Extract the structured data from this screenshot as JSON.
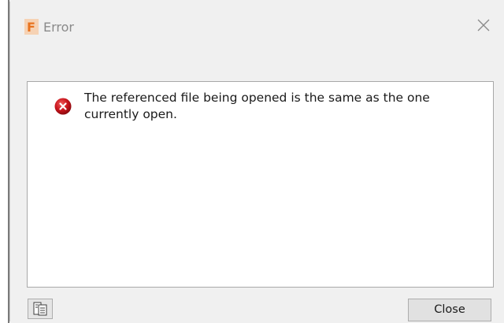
{
  "window": {
    "title": "Error",
    "app_icon_letter": "F",
    "app_icon_color": "#e8731f"
  },
  "message": {
    "text": "The referenced file being opened is the same as the one currently open.",
    "icon": "error-icon",
    "icon_color": "#c8141c"
  },
  "buttons": {
    "close_label": "Close",
    "details_icon": "details-icon"
  }
}
